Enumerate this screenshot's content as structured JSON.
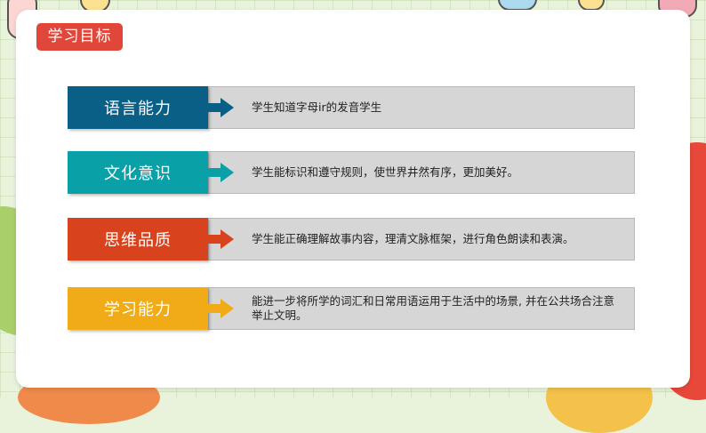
{
  "title": "学习目标",
  "colors": {
    "title_bg": "#e1463a",
    "row1": "#0a5f86",
    "row2": "#0aa0a8",
    "row3": "#d8421c",
    "row4": "#f0ab17",
    "text_box": "#d6d6d6"
  },
  "objectives": [
    {
      "label": "语言能力",
      "text": "学生知道字母ir的发音学生"
    },
    {
      "label": "文化意识",
      "text": "学生能标识和遵守规则，使世界井然有序，更加美好。"
    },
    {
      "label": "思维品质",
      "text": "学生能正确理解故事内容，理清文脉框架，进行角色朗读和表演。"
    },
    {
      "label": "学习能力",
      "text": "能进一步将所学的词汇和日常用语运用于生活中的场景, 并在公共场合注意举止文明。"
    }
  ]
}
